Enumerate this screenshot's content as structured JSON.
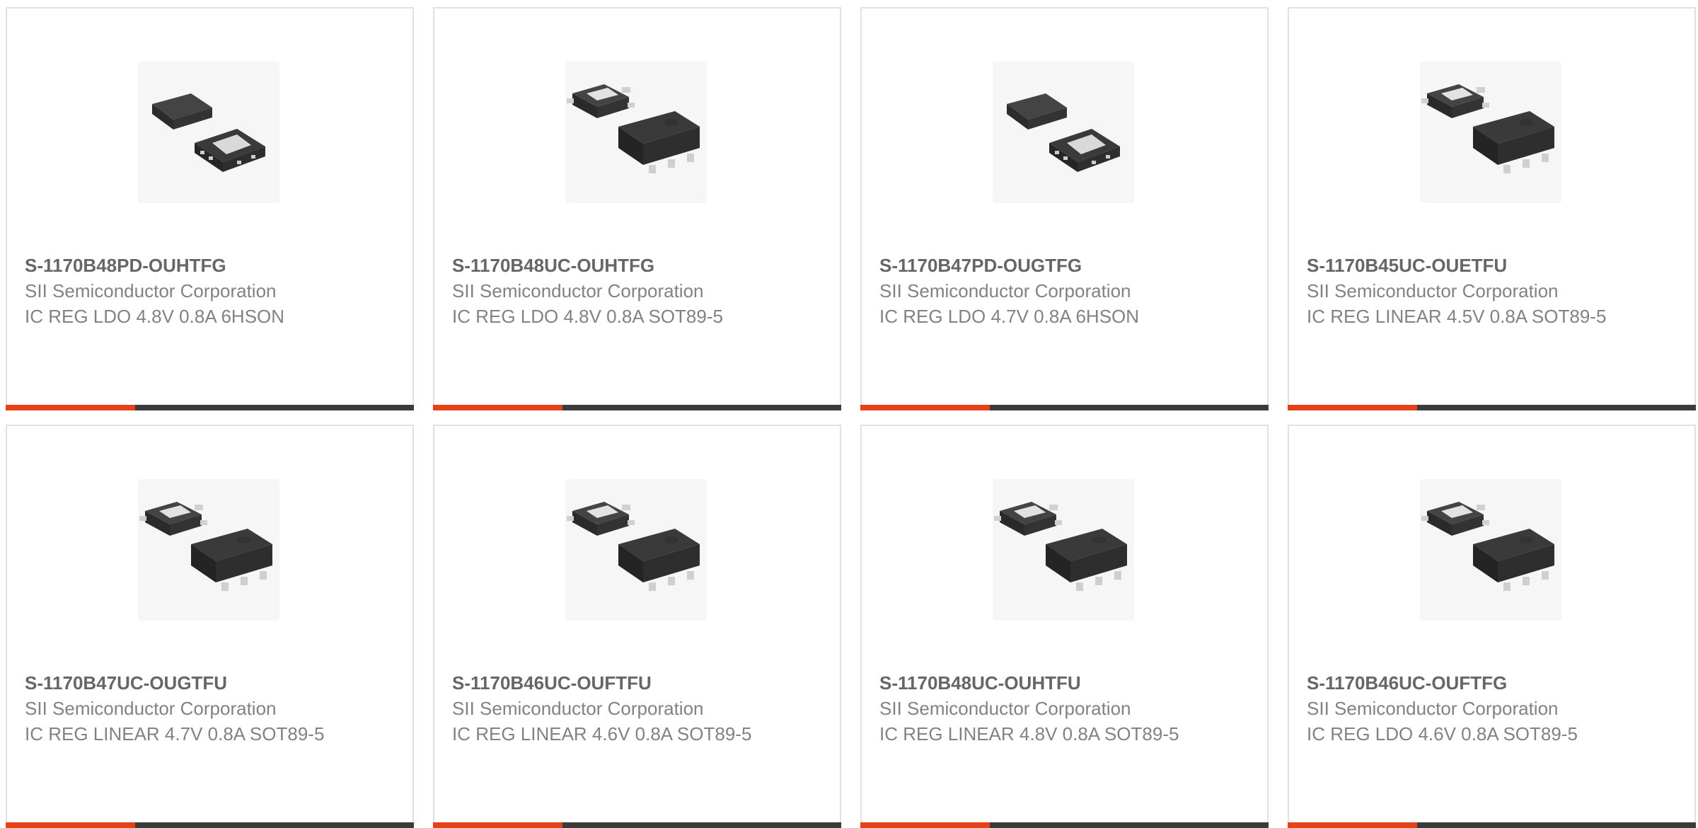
{
  "colors": {
    "accent": "#e5421a",
    "bar": "#3b3b3b",
    "title": "#666666",
    "text": "#828282",
    "border": "#e1e1e1"
  },
  "products": [
    {
      "part_number": "S-1170B48PD-OUHTFG",
      "manufacturer": "SII Semiconductor Corporation",
      "description": "IC REG LDO 4.8V 0.8A 6HSON",
      "package_icon": "6hson-package-icon"
    },
    {
      "part_number": "S-1170B48UC-OUHTFG",
      "manufacturer": "SII Semiconductor Corporation",
      "description": "IC REG LDO 4.8V 0.8A SOT89-5",
      "package_icon": "sot89-package-icon"
    },
    {
      "part_number": "S-1170B47PD-OUGTFG",
      "manufacturer": "SII Semiconductor Corporation",
      "description": "IC REG LDO 4.7V 0.8A 6HSON",
      "package_icon": "6hson-package-icon"
    },
    {
      "part_number": "S-1170B45UC-OUETFU",
      "manufacturer": "SII Semiconductor Corporation",
      "description": "IC REG LINEAR 4.5V 0.8A SOT89-5",
      "package_icon": "sot89-package-icon"
    },
    {
      "part_number": "S-1170B47UC-OUGTFU",
      "manufacturer": "SII Semiconductor Corporation",
      "description": "IC REG LINEAR 4.7V 0.8A SOT89-5",
      "package_icon": "sot89-package-icon"
    },
    {
      "part_number": "S-1170B46UC-OUFTFU",
      "manufacturer": "SII Semiconductor Corporation",
      "description": "IC REG LINEAR 4.6V 0.8A SOT89-5",
      "package_icon": "sot89-package-icon"
    },
    {
      "part_number": "S-1170B48UC-OUHTFU",
      "manufacturer": "SII Semiconductor Corporation",
      "description": "IC REG LINEAR 4.8V 0.8A SOT89-5",
      "package_icon": "sot89-package-icon"
    },
    {
      "part_number": "S-1170B46UC-OUFTFG",
      "manufacturer": "SII Semiconductor Corporation",
      "description": "IC REG LDO 4.6V 0.8A SOT89-5",
      "package_icon": "sot89-package-icon"
    }
  ]
}
